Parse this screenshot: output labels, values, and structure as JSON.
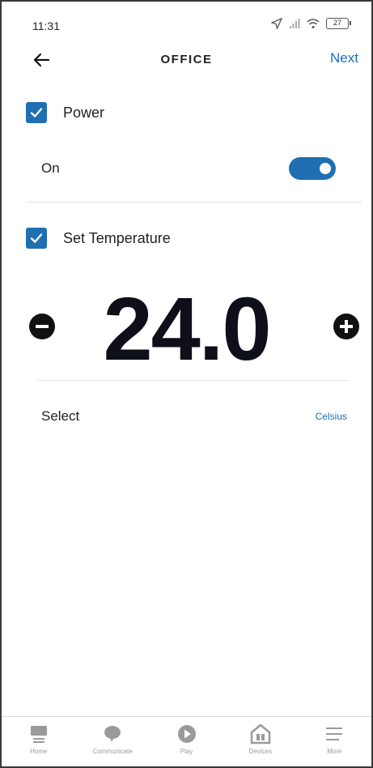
{
  "status_bar": {
    "time": "11:31",
    "battery": "27"
  },
  "app_bar": {
    "title": "OFFICE",
    "next_label": "Next"
  },
  "power": {
    "label": "Power",
    "checked": true,
    "state_label": "On",
    "toggle_on": true
  },
  "temperature": {
    "label": "Set Temperature",
    "checked": true,
    "value": "24.0"
  },
  "unit": {
    "label": "Select",
    "value": "Celsius"
  },
  "bottom_nav": {
    "items": [
      {
        "label": "Home",
        "icon": "home-icon"
      },
      {
        "label": "Communicate",
        "icon": "chat-bubble-icon"
      },
      {
        "label": "Play",
        "icon": "play-icon"
      },
      {
        "label": "Devices",
        "icon": "devices-icon"
      },
      {
        "label": "More",
        "icon": "menu-icon"
      }
    ]
  },
  "colors": {
    "accent": "#1f6fb2",
    "link": "#1d6fb8",
    "temp_text": "#0f0f1a"
  }
}
